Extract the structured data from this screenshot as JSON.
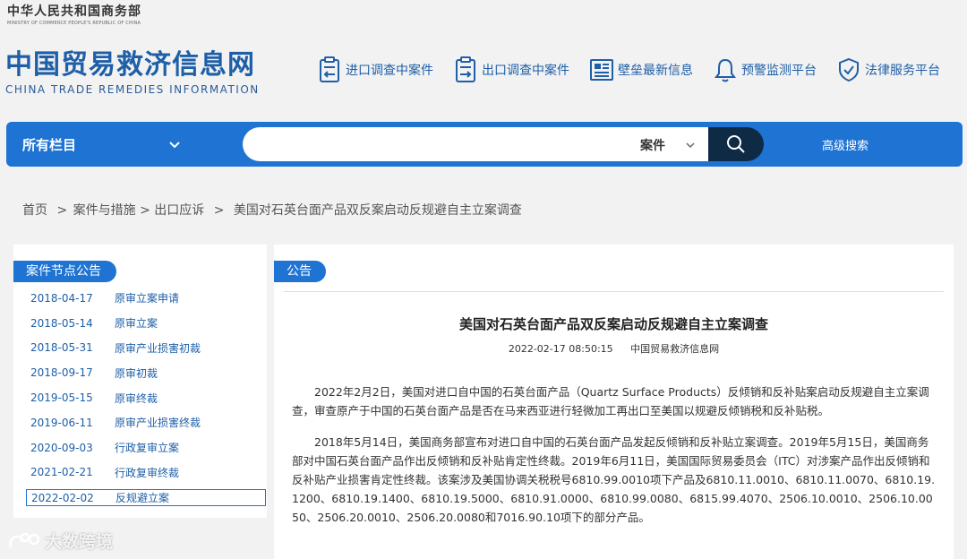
{
  "ministry": {
    "cn": "中华人民共和国商务部",
    "en": "MINISTRY OF COMMERCE PEOPLE'S REPUBLIC OF CHINA"
  },
  "logo": {
    "cn": "中国贸易救济信息网",
    "en": "CHINA TRADE REMEDIES INFORMATION"
  },
  "topnav": [
    {
      "label": "进口调查中案件",
      "icon": "import-case-icon"
    },
    {
      "label": "出口调查中案件",
      "icon": "export-case-icon"
    },
    {
      "label": "壁垒最新信息",
      "icon": "barrier-news-icon"
    },
    {
      "label": "预警监测平台",
      "icon": "bell-icon"
    },
    {
      "label": "法律服务平台",
      "icon": "shield-check-icon"
    }
  ],
  "search": {
    "category": "所有栏目",
    "placeholder": "",
    "type": "案件",
    "advanced": "高级搜索"
  },
  "breadcrumb": {
    "home": "首页",
    "sep": ">",
    "level1": "案件与措施",
    "level2": "出口应诉",
    "current": "美国对石英台面产品双反案启动反规避自主立案调查"
  },
  "sidebar": {
    "title": "案件节点公告",
    "items": [
      {
        "date": "2018-04-17",
        "label": "原审立案申请"
      },
      {
        "date": "2018-05-14",
        "label": "原审立案"
      },
      {
        "date": "2018-05-31",
        "label": "原审产业损害初裁"
      },
      {
        "date": "2018-09-17",
        "label": "原审初裁"
      },
      {
        "date": "2019-05-15",
        "label": "原审终裁"
      },
      {
        "date": "2019-06-11",
        "label": "原审产业损害终裁"
      },
      {
        "date": "2020-09-03",
        "label": "行政复审立案"
      },
      {
        "date": "2021-02-21",
        "label": "行政复审终裁"
      },
      {
        "date": "2022-02-02",
        "label": "反规避立案"
      }
    ]
  },
  "article": {
    "section": "公告",
    "title": "美国对石英台面产品双反案启动反规避自主立案调查",
    "datetime": "2022-02-17 08:50:15",
    "source": "中国贸易救济信息网",
    "paragraphs": [
      "2022年2月2日，美国对进口自中国的石英台面产品（Quartz Surface Products）反倾销和反补贴案启动反规避自主立案调查，审查原产于中国的石英台面产品是否在马来西亚进行轻微加工再出口至美国以规避反倾销税和反补贴税。",
      "2018年5月14日，美国商务部宣布对进口自中国的石英台面产品发起反倾销和反补贴立案调查。2019年5月15日，美国商务部对中国石英台面产品作出反倾销和反补贴肯定性终裁。2019年6月11日，美国国际贸易委员会（ITC）对涉案产品作出反倾销和反补贴产业损害肯定性终裁。该案涉及美国协调关税税号6810.99.0010项下产品及6810.11.0010、6810.11.0070、6810.19.1200、6810.19.1400、6810.19.5000、6810.91.0000、6810.99.0080、6815.99.4070、2506.10.0010、2506.10.0050、2506.20.0010、2506.20.0080和7016.90.10项下的部分产品。"
    ]
  },
  "watermark": "大数跨境",
  "colors": {
    "brand_blue": "#1e73d3",
    "logo_blue": "#1e5fa8",
    "search_button": "#0f2a45"
  }
}
